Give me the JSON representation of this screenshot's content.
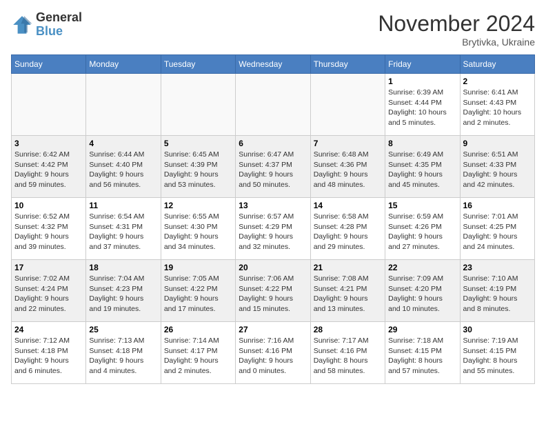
{
  "header": {
    "logo_general": "General",
    "logo_blue": "Blue",
    "month_title": "November 2024",
    "location": "Brytivka, Ukraine"
  },
  "weekdays": [
    "Sunday",
    "Monday",
    "Tuesday",
    "Wednesday",
    "Thursday",
    "Friday",
    "Saturday"
  ],
  "weeks": [
    [
      {
        "day": "",
        "info": ""
      },
      {
        "day": "",
        "info": ""
      },
      {
        "day": "",
        "info": ""
      },
      {
        "day": "",
        "info": ""
      },
      {
        "day": "",
        "info": ""
      },
      {
        "day": "1",
        "info": "Sunrise: 6:39 AM\nSunset: 4:44 PM\nDaylight: 10 hours\nand 5 minutes."
      },
      {
        "day": "2",
        "info": "Sunrise: 6:41 AM\nSunset: 4:43 PM\nDaylight: 10 hours\nand 2 minutes."
      }
    ],
    [
      {
        "day": "3",
        "info": "Sunrise: 6:42 AM\nSunset: 4:42 PM\nDaylight: 9 hours\nand 59 minutes."
      },
      {
        "day": "4",
        "info": "Sunrise: 6:44 AM\nSunset: 4:40 PM\nDaylight: 9 hours\nand 56 minutes."
      },
      {
        "day": "5",
        "info": "Sunrise: 6:45 AM\nSunset: 4:39 PM\nDaylight: 9 hours\nand 53 minutes."
      },
      {
        "day": "6",
        "info": "Sunrise: 6:47 AM\nSunset: 4:37 PM\nDaylight: 9 hours\nand 50 minutes."
      },
      {
        "day": "7",
        "info": "Sunrise: 6:48 AM\nSunset: 4:36 PM\nDaylight: 9 hours\nand 48 minutes."
      },
      {
        "day": "8",
        "info": "Sunrise: 6:49 AM\nSunset: 4:35 PM\nDaylight: 9 hours\nand 45 minutes."
      },
      {
        "day": "9",
        "info": "Sunrise: 6:51 AM\nSunset: 4:33 PM\nDaylight: 9 hours\nand 42 minutes."
      }
    ],
    [
      {
        "day": "10",
        "info": "Sunrise: 6:52 AM\nSunset: 4:32 PM\nDaylight: 9 hours\nand 39 minutes."
      },
      {
        "day": "11",
        "info": "Sunrise: 6:54 AM\nSunset: 4:31 PM\nDaylight: 9 hours\nand 37 minutes."
      },
      {
        "day": "12",
        "info": "Sunrise: 6:55 AM\nSunset: 4:30 PM\nDaylight: 9 hours\nand 34 minutes."
      },
      {
        "day": "13",
        "info": "Sunrise: 6:57 AM\nSunset: 4:29 PM\nDaylight: 9 hours\nand 32 minutes."
      },
      {
        "day": "14",
        "info": "Sunrise: 6:58 AM\nSunset: 4:28 PM\nDaylight: 9 hours\nand 29 minutes."
      },
      {
        "day": "15",
        "info": "Sunrise: 6:59 AM\nSunset: 4:26 PM\nDaylight: 9 hours\nand 27 minutes."
      },
      {
        "day": "16",
        "info": "Sunrise: 7:01 AM\nSunset: 4:25 PM\nDaylight: 9 hours\nand 24 minutes."
      }
    ],
    [
      {
        "day": "17",
        "info": "Sunrise: 7:02 AM\nSunset: 4:24 PM\nDaylight: 9 hours\nand 22 minutes."
      },
      {
        "day": "18",
        "info": "Sunrise: 7:04 AM\nSunset: 4:23 PM\nDaylight: 9 hours\nand 19 minutes."
      },
      {
        "day": "19",
        "info": "Sunrise: 7:05 AM\nSunset: 4:22 PM\nDaylight: 9 hours\nand 17 minutes."
      },
      {
        "day": "20",
        "info": "Sunrise: 7:06 AM\nSunset: 4:22 PM\nDaylight: 9 hours\nand 15 minutes."
      },
      {
        "day": "21",
        "info": "Sunrise: 7:08 AM\nSunset: 4:21 PM\nDaylight: 9 hours\nand 13 minutes."
      },
      {
        "day": "22",
        "info": "Sunrise: 7:09 AM\nSunset: 4:20 PM\nDaylight: 9 hours\nand 10 minutes."
      },
      {
        "day": "23",
        "info": "Sunrise: 7:10 AM\nSunset: 4:19 PM\nDaylight: 9 hours\nand 8 minutes."
      }
    ],
    [
      {
        "day": "24",
        "info": "Sunrise: 7:12 AM\nSunset: 4:18 PM\nDaylight: 9 hours\nand 6 minutes."
      },
      {
        "day": "25",
        "info": "Sunrise: 7:13 AM\nSunset: 4:18 PM\nDaylight: 9 hours\nand 4 minutes."
      },
      {
        "day": "26",
        "info": "Sunrise: 7:14 AM\nSunset: 4:17 PM\nDaylight: 9 hours\nand 2 minutes."
      },
      {
        "day": "27",
        "info": "Sunrise: 7:16 AM\nSunset: 4:16 PM\nDaylight: 9 hours\nand 0 minutes."
      },
      {
        "day": "28",
        "info": "Sunrise: 7:17 AM\nSunset: 4:16 PM\nDaylight: 8 hours\nand 58 minutes."
      },
      {
        "day": "29",
        "info": "Sunrise: 7:18 AM\nSunset: 4:15 PM\nDaylight: 8 hours\nand 57 minutes."
      },
      {
        "day": "30",
        "info": "Sunrise: 7:19 AM\nSunset: 4:15 PM\nDaylight: 8 hours\nand 55 minutes."
      }
    ]
  ]
}
